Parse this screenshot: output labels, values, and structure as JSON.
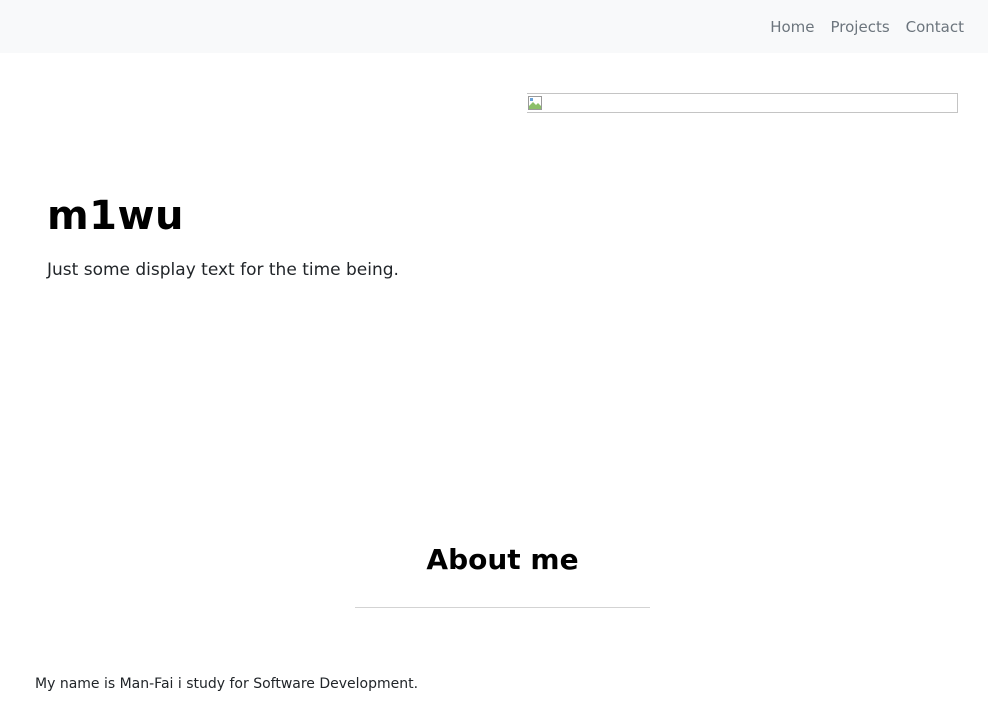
{
  "navbar": {
    "links": [
      {
        "label": "Home"
      },
      {
        "label": "Projects"
      },
      {
        "label": "Contact"
      }
    ]
  },
  "hero": {
    "image_icon": "broken-image-icon",
    "title": "m1wu",
    "subtitle": "Just some display text for the time being."
  },
  "about": {
    "heading": "About me",
    "text": "My name is Man-Fai i study for Software Development."
  },
  "colors": {
    "navbar_bg": "#f8f9fa",
    "nav_link": "#6c757d",
    "text": "#212529",
    "heading": "#000000"
  }
}
